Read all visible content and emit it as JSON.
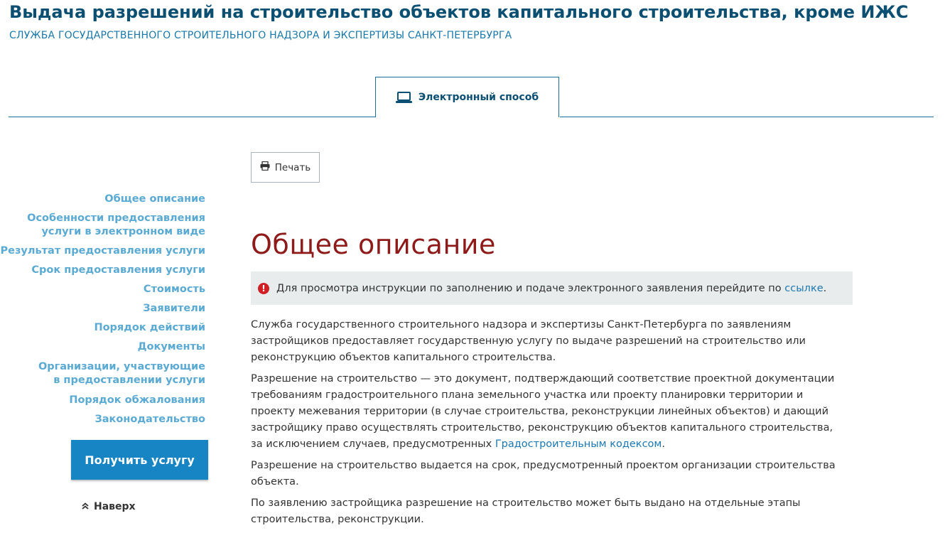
{
  "header": {
    "title": "Выдача разрешений на строительство объектов капитального строительства, кроме ИЖС",
    "subtitle": "СЛУЖБА ГОСУДАРСТВЕННОГО СТРОИТЕЛЬНОГО НАДЗОРА И ЭКСПЕРТИЗЫ САНКТ-ПЕТЕРБУРГА"
  },
  "tabs": [
    {
      "label": "Электронный способ",
      "icon": "laptop-icon",
      "active": true
    }
  ],
  "sidebar": {
    "items": [
      {
        "label": "Общее описание"
      },
      {
        "label_lines": [
          "Особенности предоставления",
          "услуги в электронном виде"
        ]
      },
      {
        "label": "Результат предоставления услуги"
      },
      {
        "label": "Срок предоставления услуги"
      },
      {
        "label": "Стоимость"
      },
      {
        "label": "Заявители"
      },
      {
        "label": "Порядок действий"
      },
      {
        "label": "Документы"
      },
      {
        "label_lines": [
          "Организации, участвующие",
          "в предоставлении услуги"
        ]
      },
      {
        "label": "Порядок обжалования"
      },
      {
        "label": "Законодательство"
      }
    ],
    "get_service_label": "Получить услугу",
    "to_top_label": "Наверх"
  },
  "toolbar": {
    "print_label": "Печать"
  },
  "main": {
    "section_title": "Общее описание",
    "alert": {
      "text": "Для просмотра инструкции по заполнению и подаче электронного заявления перейдите по ",
      "link_text": "ссылке",
      "suffix": "."
    },
    "paragraphs": {
      "p1": "Служба государственного строительного надзора и экспертизы Санкт-Петербурга по заявлениям застройщиков предоставляет государственную услугу по выдаче разрешений на строительство или реконструкцию объектов капитального строительства.",
      "p2_before": "Разрешение на строительство — это документ, подтверждающий соответствие проектной документации требованиям градостроительного плана земельного участка или проекту планировки территории и проекту межевания территории (в случае строительства, реконструкции линейных объектов) и дающий застройщику право осуществлять строительство, реконструкцию объектов капитального строительства, за исключением случаев, предусмотренных ",
      "p2_link": "Градостроительным кодексом",
      "p2_after": ".",
      "p3": "Разрешение на строительство выдается на срок, предусмотренный проектом организации строительства объекта.",
      "p4": "По заявлению застройщика разрешение на строительство может быть выдано на отдельные этапы строительства, реконструкции."
    }
  },
  "colors": {
    "title": "#0b4f72",
    "subtitle": "#1878a9",
    "sidebar_link": "#5aaad3",
    "section_title": "#8e1a1a",
    "primary_button": "#1785c3",
    "alert_bg": "#e9eced",
    "alert_icon": "#d11f26",
    "link": "#1b78b0"
  }
}
